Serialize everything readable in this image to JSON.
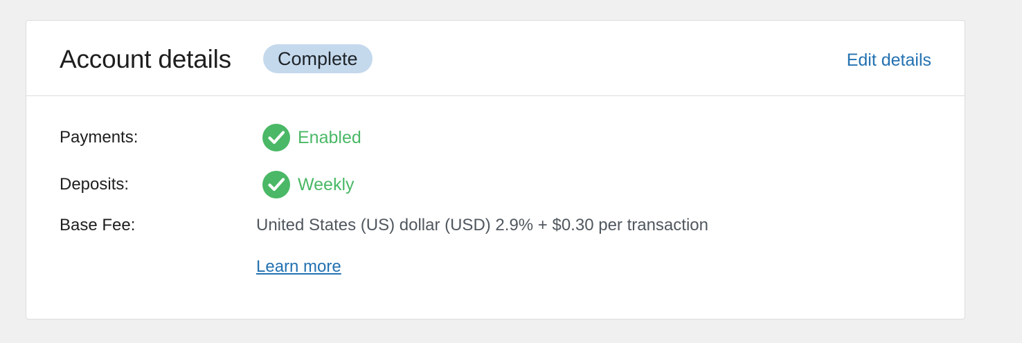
{
  "card": {
    "title": "Account details",
    "badge": "Complete",
    "edit_label": "Edit details"
  },
  "rows": {
    "payments": {
      "label": "Payments:",
      "value": "Enabled"
    },
    "deposits": {
      "label": "Deposits:",
      "value": "Weekly"
    },
    "base_fee": {
      "label": "Base Fee:",
      "value": "United States (US) dollar (USD) 2.9% + $0.30 per transaction",
      "link_label": "Learn more"
    }
  },
  "icons": {
    "status": "check-circle-icon"
  },
  "colors": {
    "background": "#f0f0f1",
    "badge_bg": "#c5d9ed",
    "link": "#2271b1",
    "success": "#4ab866",
    "muted_text": "#50575e"
  }
}
